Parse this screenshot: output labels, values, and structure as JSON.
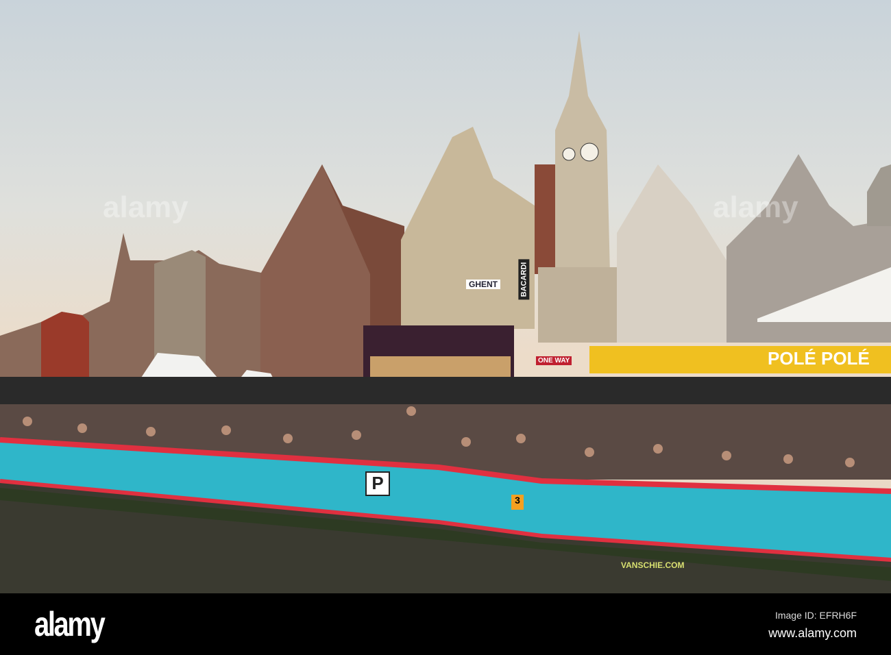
{
  "photo": {
    "signs": {
      "bacardi": "BACARDI",
      "banner": "POLÉ POLÉ",
      "one_way": "ONE WAY",
      "ghent": "GHENT",
      "fence_brand": "VANSCHIE.COM",
      "number": "3",
      "parking": "P"
    },
    "watermark": "alamy"
  },
  "footer": {
    "logo": "alamy",
    "image_id": "Image ID: EFRH6F",
    "website": "www.alamy.com"
  },
  "colors": {
    "fence_blue": "#2fb6c9",
    "fence_red": "#e03040",
    "water": "#3a3a30",
    "banner_yellow": "#f0c020"
  }
}
